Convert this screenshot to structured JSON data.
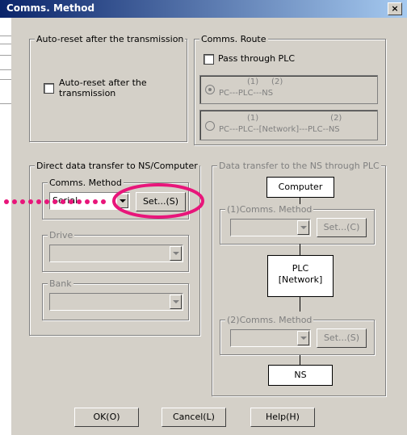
{
  "window": {
    "title": "Comms. Method",
    "close_label": "×"
  },
  "auto_reset": {
    "legend": "Auto-reset after the transmission",
    "checkbox_label": "Auto-reset after the transmission"
  },
  "comms_route": {
    "legend": "Comms. Route",
    "pass_through_label": "Pass through PLC",
    "option1_nums": "(1)     (2)",
    "option1_path": "PC---PLC---NS",
    "option2_nums": "(1)                            (2)",
    "option2_path": "PC---PLC--[Network]---PLC--NS"
  },
  "direct_transfer": {
    "legend": "Direct data transfer to NS/Computer",
    "comms_method_legend": "Comms. Method",
    "comms_method_value": "Serial",
    "set_button": "Set...(S)",
    "drive_legend": "Drive",
    "bank_legend": "Bank"
  },
  "plc_transfer": {
    "legend": "Data transfer to the NS through PLC",
    "computer_label": "Computer",
    "comms1_legend": "(1)Comms. Method",
    "set_c_button": "Set...(C)",
    "plc_label_1": "PLC",
    "plc_label_2": "[Network]",
    "comms2_legend": "(2)Comms. Method",
    "set_s_button": "Set...(S)",
    "ns_label": "NS"
  },
  "buttons": {
    "ok": "OK(O)",
    "cancel": "Cancel(L)",
    "help": "Help(H)"
  },
  "annotation": {
    "highlight_color": "#e8157a"
  }
}
